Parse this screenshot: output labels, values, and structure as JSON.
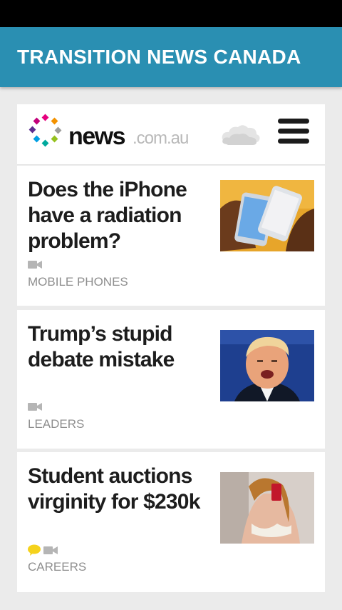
{
  "app": {
    "title": "TRANSITION NEWS CANADA"
  },
  "site": {
    "logo_bold": "news",
    "logo_light": ".com.au"
  },
  "articles": [
    {
      "title": "Does the iPhone have a radiation problem?",
      "category": "MOBILE PHONES",
      "has_video": true,
      "has_comments": false
    },
    {
      "title": "Trump’s stupid debate mistake",
      "category": "LEADERS",
      "has_video": true,
      "has_comments": false
    },
    {
      "title": "Student auctions virginity for $230k",
      "category": "CAREERS",
      "has_video": true,
      "has_comments": true
    }
  ],
  "colors": {
    "appbar": "#2a8fb2",
    "comment_icon": "#f5d21c",
    "category_text": "#8e8e8e"
  }
}
